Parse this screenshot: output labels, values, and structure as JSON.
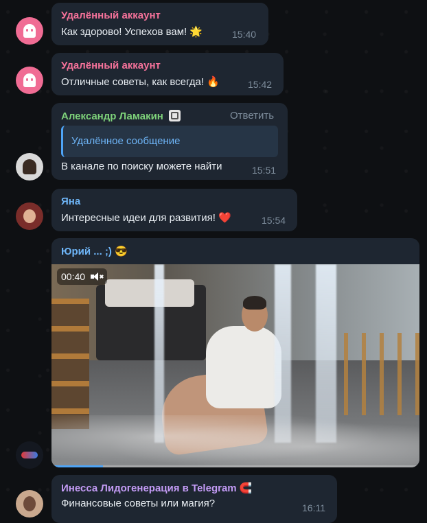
{
  "messages": [
    {
      "author": "Удалённый аккаунт",
      "text": "Как здорово! Успехов вам!",
      "emoji": "🌟",
      "time": "15:40",
      "author_color": "#f5729a",
      "avatar": "ghost-icon"
    },
    {
      "author": "Удалённый аккаунт",
      "text": "Отличные советы, как всегда!",
      "emoji": "🔥",
      "time": "15:42",
      "author_color": "#f5729a",
      "avatar": "ghost-icon"
    },
    {
      "author": "Александр Ламакин",
      "badge": "🅿",
      "reply_label": "Ответить",
      "quote": "Удалённое сообщение",
      "text": "В канале по поиску можете найти",
      "time": "15:51",
      "author_color": "#7ed27a"
    },
    {
      "author": "Яна",
      "text": "Интересные идеи для развития!",
      "emoji": "❤️",
      "time": "15:54",
      "author_color": "#6eb5f7"
    },
    {
      "author": "Юрий ... ;)",
      "emoji": "😎",
      "video_duration": "00:40",
      "muted": true,
      "progress": 0.14,
      "author_color": "#6eb5f7"
    },
    {
      "author": "Инесса Лидогенерация в Telegram",
      "emoji": "🧲",
      "text": "Финансовые советы или магия?",
      "time": "16:11",
      "author_color": "#c39bf5"
    }
  ],
  "colors": {
    "bubble": "#1e2631",
    "accent": "#4ea4f6",
    "background": "#0e1013"
  }
}
